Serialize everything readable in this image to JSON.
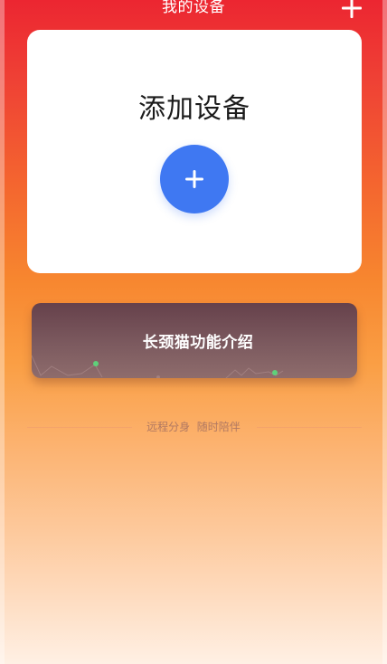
{
  "header": {
    "title": "我的设备",
    "add_icon": "plus-icon"
  },
  "add_card": {
    "title": "添加设备",
    "button_icon": "plus-icon",
    "button_color": "#3f78f2"
  },
  "feature_banner": {
    "title": "长颈猫功能介绍"
  },
  "slogan": {
    "text": "远程分身  随时陪伴"
  },
  "colors": {
    "gradient_top": "#ec2631",
    "gradient_mid": "#f7862f",
    "gradient_bottom": "#fff0e4",
    "card": "#ffffff",
    "banner": "#7c5a5f"
  }
}
